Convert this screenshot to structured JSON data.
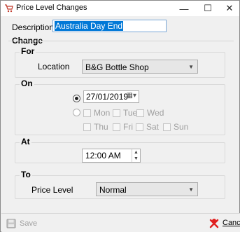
{
  "window": {
    "title": "Price Level Changes"
  },
  "description": {
    "label": "Description",
    "value": "Australia Day End"
  },
  "change": {
    "title": "Change",
    "for": {
      "title": "For",
      "location_label": "Location",
      "location_value": "B&G Bottle Shop"
    },
    "on": {
      "title": "On",
      "date_value": "27/01/2019",
      "date_selected": true,
      "days_row1": [
        "Mon",
        "Tue",
        "Wed"
      ],
      "days_row2": [
        "Thu",
        "Fri",
        "Sat",
        "Sun"
      ]
    },
    "at": {
      "title": "At",
      "time_value": "12:00 AM"
    },
    "to": {
      "title": "To",
      "price_level_label": "Price Level",
      "price_level_value": "Normal"
    }
  },
  "footer": {
    "save_label": "Save",
    "cancel_label": "Cancel"
  },
  "colors": {
    "selection": "#0078d7",
    "cancel_icon": "#e02020"
  }
}
